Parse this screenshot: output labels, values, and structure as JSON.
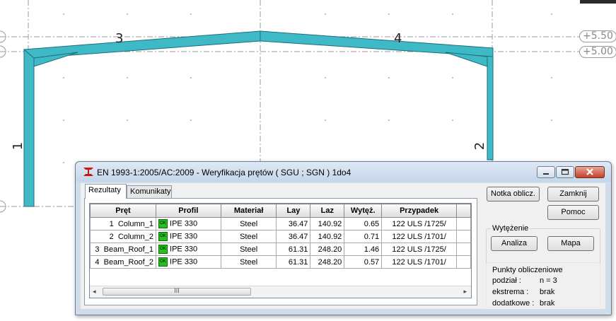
{
  "viewport": {
    "level_tags": [
      "+5.50",
      "+5.00"
    ],
    "member_labels": [
      "3",
      "4",
      "1",
      "2"
    ]
  },
  "dialog": {
    "title": "EN 1993-1:2005/AC:2009 - Weryfikacja prętów ( SGU ; SGN ) 1do4",
    "tabs": [
      "Rezultaty",
      "Komunikaty"
    ],
    "table": {
      "headers": [
        "Pręt",
        "Profil",
        "Materiał",
        "Lay",
        "Laz",
        "Wytęż.",
        "Przypadek"
      ],
      "rows": [
        {
          "id": "1",
          "name": "Column_1",
          "status": "OK",
          "profile": "IPE 330",
          "material": "Steel",
          "lay": "36.47",
          "laz": "140.92",
          "ratio": "0.65",
          "case": "122 ULS /1725/"
        },
        {
          "id": "2",
          "name": "Column_2",
          "status": "OK",
          "profile": "IPE 330",
          "material": "Steel",
          "lay": "36.47",
          "laz": "140.92",
          "ratio": "0.71",
          "case": "122 ULS /1701/"
        },
        {
          "id": "3",
          "name": "Beam_Roof_1",
          "status": "OK",
          "profile": "IPE 330",
          "material": "Steel",
          "lay": "61.31",
          "laz": "248.20",
          "ratio": "1.46",
          "case": "122 ULS /1725/"
        },
        {
          "id": "4",
          "name": "Beam_Roof_2",
          "status": "OK",
          "profile": "IPE 330",
          "material": "Steel",
          "lay": "61.31",
          "laz": "248.20",
          "ratio": "0.57",
          "case": "122 ULS /1701/"
        }
      ]
    },
    "buttons": {
      "notka": "Notka oblicz.",
      "zamknij": "Zamknij",
      "pomoc": "Pomoc",
      "analiza": "Analiza",
      "mapa": "Mapa"
    },
    "wytezenie_label": "Wytężenie",
    "punkty": {
      "label": "Punkty obliczeniowe",
      "rows": [
        {
          "key": "podział :",
          "value": "n = 3"
        },
        {
          "key": "ekstrema :",
          "value": "brak"
        },
        {
          "key": "dodatkowe :",
          "value": "brak"
        }
      ]
    },
    "scroll_thumb_glyph": "III"
  },
  "colors": {
    "member_fill": "#3fb9c6",
    "member_stroke": "#1b6f7a",
    "grid_line": "#9a9a9a"
  }
}
